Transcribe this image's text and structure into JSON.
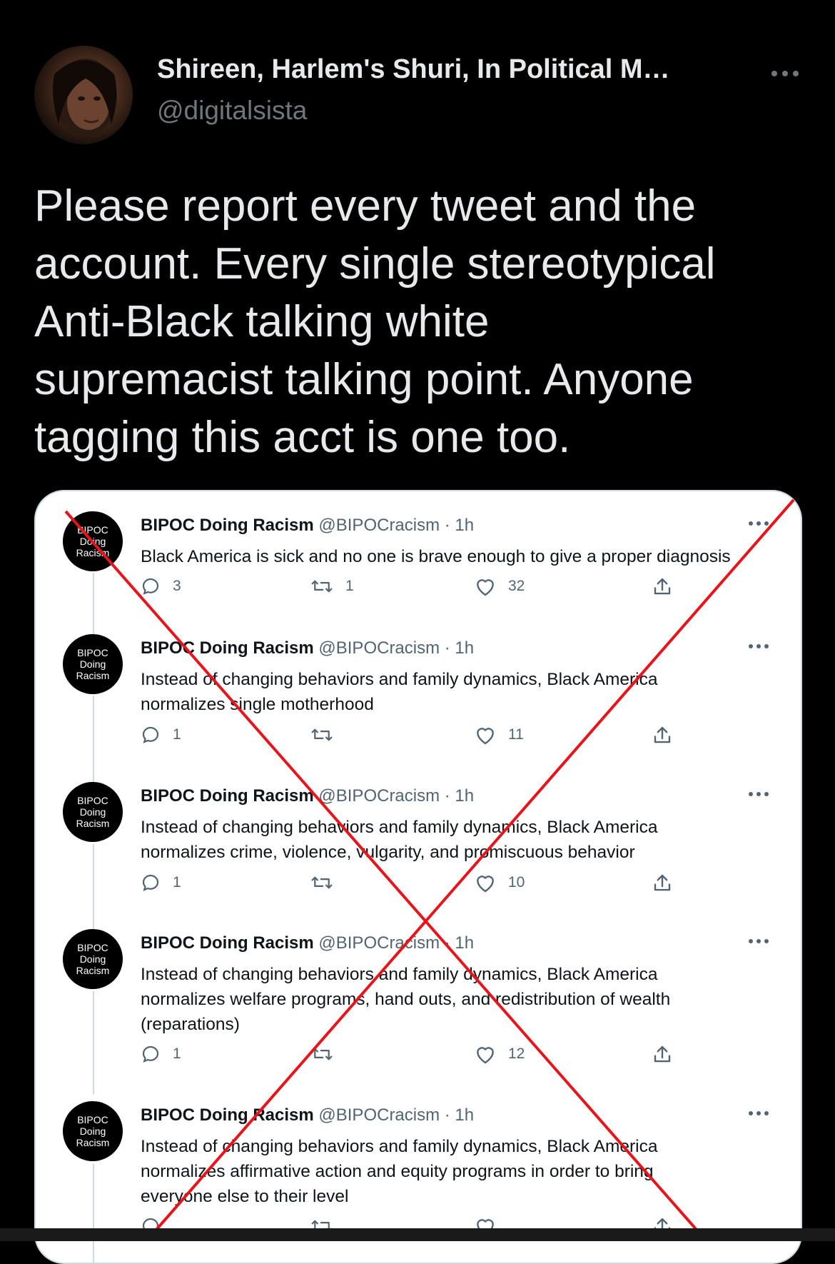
{
  "author": {
    "display_name": "Shireen, Harlem's Shuri, In Political M…",
    "handle": "@digitalsista"
  },
  "tweet": {
    "text_lines": [
      "Please report every tweet and the",
      "account. Every single stereotypical",
      "Anti-Black talking white",
      "supremacist talking point. Anyone",
      "tagging this acct is one too."
    ]
  },
  "embedded_screenshot": {
    "account_name": "BIPOC Doing Racism",
    "avatar_text": "BIPOC\nDoing\nRacism",
    "posts": [
      {
        "name": "BIPOC Doing Racism",
        "meta": "@BIPOCracism · 1h",
        "lines": [
          "Black America is sick and no one is brave enough to give a proper diagnosis"
        ],
        "replies": "3",
        "retweets": "1",
        "likes": "32"
      },
      {
        "name": "BIPOC Doing Racism",
        "meta": "@BIPOCracism · 1h",
        "lines": [
          "Instead of changing behaviors and family dynamics, Black America",
          "normalizes single motherhood"
        ],
        "replies": "1",
        "retweets": "",
        "likes": "11"
      },
      {
        "name": "BIPOC Doing Racism",
        "meta": "@BIPOCracism · 1h",
        "lines": [
          "Instead of changing behaviors and family dynamics, Black America",
          "normalizes crime, violence, vulgarity, and promiscuous behavior"
        ],
        "replies": "1",
        "retweets": "",
        "likes": "10"
      },
      {
        "name": "BIPOC Doing Racism",
        "meta": "@BIPOCracism · 1h",
        "lines": [
          "Instead of changing behaviors and family dynamics, Black America",
          "normalizes welfare programs, hand outs, and redistribution of wealth",
          "(reparations)"
        ],
        "replies": "1",
        "retweets": "",
        "likes": "12"
      },
      {
        "name": "BIPOC Doing Racism",
        "meta": "@BIPOCracism · 1h",
        "lines": [
          "Instead of changing behaviors and family dynamics, Black America",
          "normalizes affirmative action and equity programs in order to bring",
          "everyone else to their level"
        ],
        "replies": "",
        "retweets": "",
        "likes": ""
      }
    ]
  },
  "colors": {
    "background": "#000000",
    "text": "#e7e9ea",
    "secondary": "#71767b",
    "cross_mark": "#e8141c"
  },
  "icons": [
    "more-horizontal-icon",
    "reply-icon",
    "retweet-icon",
    "like-icon",
    "share-icon"
  ]
}
